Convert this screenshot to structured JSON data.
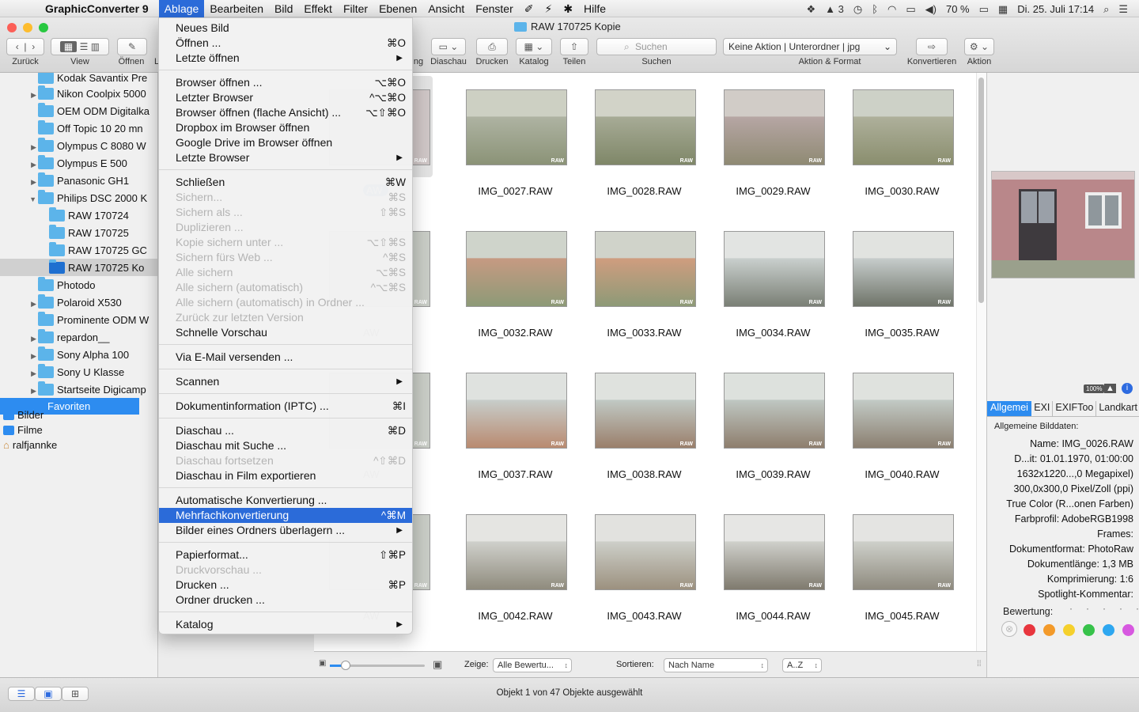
{
  "menubar": {
    "app": "GraphicConverter 9",
    "items": [
      "Ablage",
      "Bearbeiten",
      "Bild",
      "Effekt",
      "Filter",
      "Ebenen",
      "Ansicht",
      "Fenster"
    ],
    "help": "Hilfe",
    "adobe_count": "3",
    "battery": "70 %",
    "clock": "Di. 25. Juli  17:14"
  },
  "window": {
    "title": "RAW 170725 Kopie"
  },
  "toolbar": {
    "labels": [
      "Zurück",
      "View",
      "Öffnen",
      "L",
      "ng",
      "Diaschau",
      "Drucken",
      "Katalog",
      "Teilen",
      "Suchen",
      "Aktion & Format",
      "Konvertieren",
      "Aktion"
    ],
    "search_placeholder": "Suchen",
    "action_value": "Keine Aktion | Unterordner | jpg"
  },
  "sidebar": {
    "items": [
      {
        "label": "Kodak Savantix Pre",
        "arrow": ""
      },
      {
        "label": "Nikon Coolpix 5000",
        "arrow": "▶"
      },
      {
        "label": "OEM ODM Digitalka",
        "arrow": ""
      },
      {
        "label": "Off Topic 10 20 mn",
        "arrow": ""
      },
      {
        "label": "Olympus C 8080 W",
        "arrow": "▶"
      },
      {
        "label": "Olympus E 500",
        "arrow": "▶"
      },
      {
        "label": "Panasonic GH1",
        "arrow": "▶"
      },
      {
        "label": "Philips DSC 2000 K",
        "arrow": "▼"
      },
      {
        "label": "RAW 170724",
        "arrow": ""
      },
      {
        "label": "RAW 170725",
        "arrow": ""
      },
      {
        "label": "RAW 170725 GC",
        "arrow": ""
      },
      {
        "label": "RAW 170725 Ko",
        "arrow": ""
      },
      {
        "label": "Photodo",
        "arrow": ""
      },
      {
        "label": "Polaroid X530",
        "arrow": "▶"
      },
      {
        "label": "Prominente ODM W",
        "arrow": ""
      },
      {
        "label": "repardon__",
        "arrow": "▶"
      },
      {
        "label": "Sony Alpha 100",
        "arrow": "▶"
      },
      {
        "label": "Sony U Klasse",
        "arrow": "▶"
      },
      {
        "label": "Startseite Digicamp",
        "arrow": "▶"
      }
    ],
    "favorites_header": "Favoriten",
    "favorites": [
      "Bilder",
      "Filme",
      "ralfjannke"
    ]
  },
  "menu": {
    "items": [
      {
        "label": "Neues Bild",
        "shortcut": "",
        "arrow": "",
        "disabled": false
      },
      {
        "label": "Öffnen ...",
        "shortcut": "⌘O",
        "arrow": "",
        "disabled": false
      },
      {
        "label": "Letzte öffnen",
        "shortcut": "",
        "arrow": "▶",
        "disabled": false
      },
      {
        "label": "Browser öffnen ...",
        "shortcut": "⌥⌘O",
        "arrow": "",
        "disabled": false
      },
      {
        "label": "Letzter Browser",
        "shortcut": "^⌥⌘O",
        "arrow": "",
        "disabled": false
      },
      {
        "label": "Browser öffnen (flache Ansicht) ...",
        "shortcut": "⌥⇧⌘O",
        "arrow": "",
        "disabled": false
      },
      {
        "label": "Dropbox im Browser öffnen",
        "shortcut": "",
        "arrow": "",
        "disabled": false
      },
      {
        "label": "Google Drive im Browser öffnen",
        "shortcut": "",
        "arrow": "",
        "disabled": false
      },
      {
        "label": "Letzte Browser",
        "shortcut": "",
        "arrow": "▶",
        "disabled": false
      },
      {
        "label": "Schließen",
        "shortcut": "⌘W",
        "arrow": "",
        "disabled": false
      },
      {
        "label": "Sichern...",
        "shortcut": "⌘S",
        "arrow": "",
        "disabled": true
      },
      {
        "label": "Sichern als ...",
        "shortcut": "⇧⌘S",
        "arrow": "",
        "disabled": true
      },
      {
        "label": "Duplizieren ...",
        "shortcut": "",
        "arrow": "",
        "disabled": true
      },
      {
        "label": "Kopie sichern unter ...",
        "shortcut": "⌥⇧⌘S",
        "arrow": "",
        "disabled": true
      },
      {
        "label": "Sichern fürs Web ...",
        "shortcut": "^⌘S",
        "arrow": "",
        "disabled": true
      },
      {
        "label": "Alle sichern",
        "shortcut": "⌥⌘S",
        "arrow": "",
        "disabled": true
      },
      {
        "label": "Alle sichern (automatisch)",
        "shortcut": "^⌥⌘S",
        "arrow": "",
        "disabled": true
      },
      {
        "label": "Alle sichern (automatisch) in Ordner ...",
        "shortcut": "",
        "arrow": "",
        "disabled": true
      },
      {
        "label": "Zurück zur letzten Version",
        "shortcut": "",
        "arrow": "",
        "disabled": true
      },
      {
        "label": "Schnelle Vorschau",
        "shortcut": "",
        "arrow": "",
        "disabled": false
      },
      {
        "label": "Via E-Mail versenden ...",
        "shortcut": "",
        "arrow": "",
        "disabled": false
      },
      {
        "label": "Scannen",
        "shortcut": "",
        "arrow": "▶",
        "disabled": false
      },
      {
        "label": "Dokumentinformation (IPTC) ...",
        "shortcut": "⌘I",
        "arrow": "",
        "disabled": false
      },
      {
        "label": "Diaschau ...",
        "shortcut": "⌘D",
        "arrow": "",
        "disabled": false
      },
      {
        "label": "Diaschau mit Suche ...",
        "shortcut": "",
        "arrow": "",
        "disabled": false
      },
      {
        "label": "Diaschau fortsetzen",
        "shortcut": "^⇧⌘D",
        "arrow": "",
        "disabled": true
      },
      {
        "label": "Diaschau in Film exportieren",
        "shortcut": "",
        "arrow": "",
        "disabled": false
      },
      {
        "label": "Automatische Konvertierung ...",
        "shortcut": "",
        "arrow": "",
        "disabled": false
      },
      {
        "label": "Mehrfachkonvertierung",
        "shortcut": "^⌘M",
        "arrow": "",
        "disabled": false,
        "highlighted": true
      },
      {
        "label": "Bilder eines Ordners überlagern ...",
        "shortcut": "",
        "arrow": "▶",
        "disabled": false
      },
      {
        "label": "Papierformat...",
        "shortcut": "⇧⌘P",
        "arrow": "",
        "disabled": false
      },
      {
        "label": "Druckvorschau ...",
        "shortcut": "",
        "arrow": "",
        "disabled": true
      },
      {
        "label": "Drucken ...",
        "shortcut": "⌘P",
        "arrow": "",
        "disabled": false
      },
      {
        "label": "Ordner drucken ...",
        "shortcut": "",
        "arrow": "",
        "disabled": false
      },
      {
        "label": "Katalog",
        "shortcut": "",
        "arrow": "▶",
        "disabled": false
      }
    ]
  },
  "grid": {
    "rows": [
      {
        "first": "AW",
        "files": [
          "IMG_0027.RAW",
          "IMG_0028.RAW",
          "IMG_0029.RAW",
          "IMG_0030.RAW"
        ]
      },
      {
        "first": "AW",
        "files": [
          "IMG_0032.RAW",
          "IMG_0033.RAW",
          "IMG_0034.RAW",
          "IMG_0035.RAW"
        ]
      },
      {
        "first": "AW",
        "files": [
          "IMG_0037.RAW",
          "IMG_0038.RAW",
          "IMG_0039.RAW",
          "IMG_0040.RAW"
        ]
      },
      {
        "first": "AW",
        "files": [
          "IMG_0042.RAW",
          "IMG_0043.RAW",
          "IMG_0044.RAW",
          "IMG_0045.RAW"
        ]
      }
    ],
    "badge": "RAW",
    "zeige_label": "Zeige:",
    "zeige_value": "Alle Bewertu...",
    "sort_label": "Sortieren:",
    "sort_value": "Nach Name",
    "order_value": "A..Z"
  },
  "info": {
    "tabs": [
      "Allgemei",
      "EXI",
      "EXIFToo",
      "Landkart"
    ],
    "header": "Allgemeine Bilddaten:",
    "lines": [
      "Name:  IMG_0026.RAW",
      "D...it:  01.01.1970, 01:00:00",
      "1632x1220...,0 Megapixel)",
      "300,0x300,0 Pixel/Zoll (ppi)",
      "True Color (R...onen Farben)",
      "Farbprofil:  AdobeRGB1998",
      "Frames:",
      "Dokumentformat:  PhotoRaw",
      "Dokumentlänge:  1,3 MB",
      "Komprimierung:  1:6",
      "Spotlight-Kommentar:"
    ],
    "rating_label": "Bewertung:",
    "mini_label": "100%"
  },
  "status": {
    "text": "Objekt 1 von 47 Objekte ausgewählt"
  }
}
